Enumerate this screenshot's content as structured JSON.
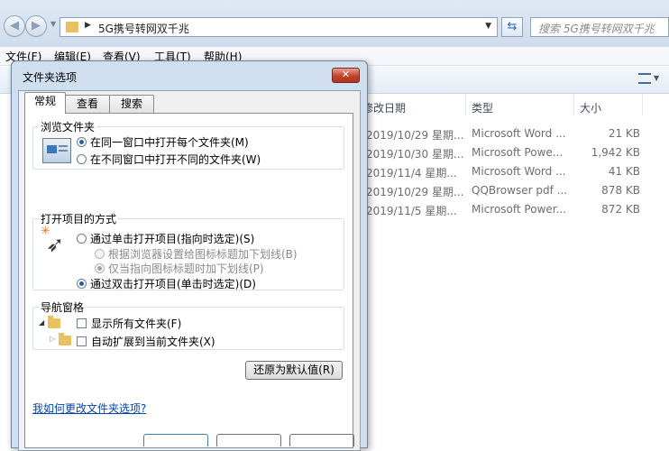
{
  "explorer": {
    "address_path": "5G携号转网双千兆",
    "search_placeholder": "搜索 5G携号转网双千兆",
    "menu": [
      "文件(F)",
      "编辑(E)",
      "查看(V)",
      "工具(T)",
      "帮助(H)"
    ],
    "columns": {
      "modified": "修改日期",
      "type": "类型",
      "size": "大小"
    },
    "rows": [
      {
        "date": "2019/10/29 星期...",
        "type": "Microsoft Word ...",
        "size": "21 KB"
      },
      {
        "date": "2019/10/30 星期...",
        "type": "Microsoft Powe...",
        "size": "1,942 KB"
      },
      {
        "date": "2019/11/4 星期...",
        "type": "Microsoft Word ...",
        "size": "41 KB"
      },
      {
        "date": "2019/10/29 星期...",
        "type": "QQBrowser pdf ...",
        "size": "878 KB"
      },
      {
        "date": "2019/11/5 星期...",
        "type": "Microsoft Power...",
        "size": "872 KB"
      }
    ]
  },
  "dialog": {
    "title": "文件夹选项",
    "close": "✕",
    "tabs": [
      "常规",
      "查看",
      "搜索"
    ],
    "browse": {
      "title": "浏览文件夹",
      "same_window": "在同一窗口中打开每个文件夹(M)",
      "new_window": "在不同窗口中打开不同的文件夹(W)"
    },
    "click": {
      "title": "打开项目的方式",
      "single": "通过单击打开项目(指向时选定)(S)",
      "underline_browser": "根据浏览器设置给图标标题加下划线(B)",
      "underline_point": "仅当指向图标标题时加下划线(P)",
      "double": "通过双击打开项目(单击时选定)(D)"
    },
    "nav": {
      "title": "导航窗格",
      "show_all": "显示所有文件夹(F)",
      "auto_expand": "自动扩展到当前文件夹(X)"
    },
    "restore_button": "还原为默认值(R)",
    "help_link": "我如何更改文件夹选项?"
  }
}
